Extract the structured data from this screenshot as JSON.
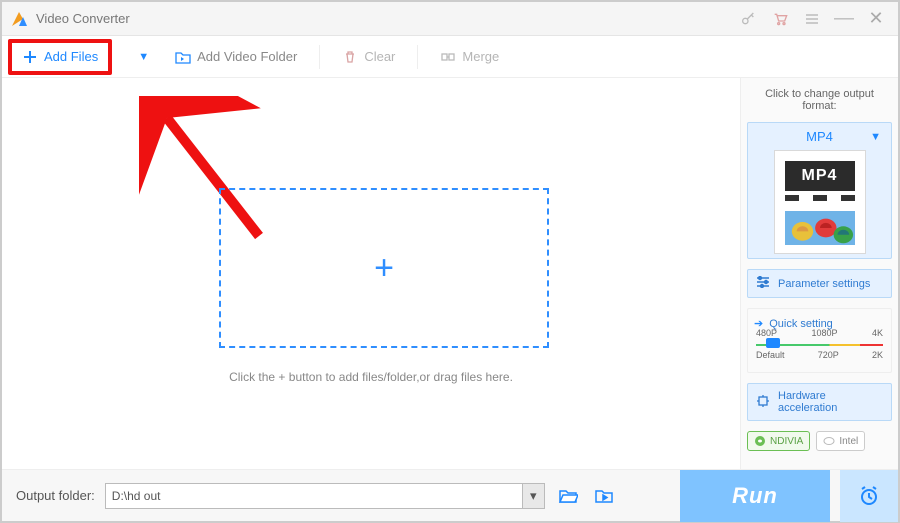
{
  "title": "Video Converter",
  "toolbar": {
    "add_files": "Add Files",
    "add_video_folder": "Add Video Folder",
    "clear": "Clear",
    "merge": "Merge"
  },
  "main": {
    "hint": "Click the + button to add files/folder,or drag files here."
  },
  "sidebar": {
    "header": "Click to change output format:",
    "format_label": "MP4",
    "thumb_band": "MP4",
    "parameter_settings": "Parameter settings",
    "quick_setting": "Quick setting",
    "scale_top": [
      "480P",
      "1080P",
      "4K"
    ],
    "scale_bot": [
      "Default",
      "720P",
      "2K"
    ],
    "hardware_accel": "Hardware acceleration",
    "badge_nvidia": "NDIVIA",
    "badge_intel": "Intel"
  },
  "bottom": {
    "output_folder_label": "Output folder:",
    "output_folder_value": "D:\\hd out",
    "run": "Run"
  }
}
